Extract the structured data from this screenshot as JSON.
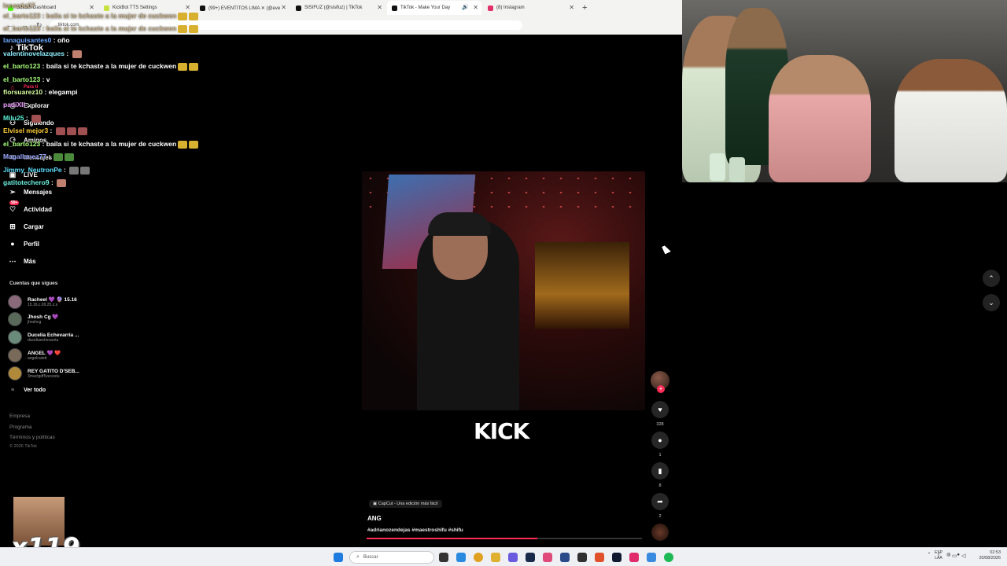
{
  "browser": {
    "tabs": [
      {
        "label": "Stream",
        "extra": "Dashboard",
        "color": "#53fc18"
      },
      {
        "label": "KickBot TTS Settings",
        "color": "#c7e23a"
      },
      {
        "label": "(99+) EVENTITOS LIMA ✕ (@eve",
        "color": "#111111"
      },
      {
        "label": "SISIFUZ (@sisifuz) | TikTok",
        "color": "#111111"
      },
      {
        "label": "TikTok - Make Your Day",
        "color": "#111111"
      },
      {
        "label": "(8) Instagram",
        "color": "#e1306c"
      }
    ],
    "active_tab": 4,
    "url": "tiktok.com",
    "new_tab": "+"
  },
  "tiktok": {
    "logo": "TikTok",
    "nav": [
      {
        "label": "Para ti",
        "icon": "home-icon"
      },
      {
        "label": "Explorar",
        "icon": "compass-icon"
      },
      {
        "label": "Siguiendo",
        "icon": "following-icon"
      },
      {
        "label": "Amigos",
        "icon": "friends-icon"
      },
      {
        "label": "Mensajes",
        "icon": "mail-icon"
      },
      {
        "label": "LIVE",
        "icon": "live-icon"
      },
      {
        "label": "Mensajes",
        "icon": "message-icon"
      },
      {
        "label": "Actividad",
        "icon": "bell-icon",
        "badge": "99+"
      },
      {
        "label": "Cargar",
        "icon": "upload-icon"
      },
      {
        "label": "Perfil",
        "icon": "profile-icon"
      },
      {
        "label": "Más",
        "icon": "more-icon"
      }
    ],
    "following_title": "Cuentas que sigues",
    "accounts": [
      {
        "name": "Racheel 💜 🔮 15.16",
        "handle": "15.16.c.09.25.z.s"
      },
      {
        "name": "Jhosh Cg 💜",
        "handle": "jhoshcg"
      },
      {
        "name": "Ducelia Echevarria ...",
        "handle": "duceliaechevarria"
      },
      {
        "name": "ANGEL 💜 ❤️",
        "handle": "angelcutett"
      },
      {
        "name": "REY GATITO D'SEB...",
        "handle": "3mactgdf5vecestu"
      }
    ],
    "see_all": "Ver todo",
    "footer": [
      "Empresa",
      "Programa",
      "Términos y políticas"
    ],
    "copyright": "© 2026 TikTok",
    "video": {
      "overlay_text": "KICK",
      "capcut": "CapCut - Una edición más fácil",
      "title": "ANG",
      "tags": "#adrianozendejas #maestroshifu #shifu",
      "progress": 0.62
    },
    "actions": {
      "likes": "328",
      "comments": "1",
      "saves": "8",
      "shares": "2"
    }
  },
  "chat": {
    "top_lines": [
      "lonardo07",
      "el_barto123 : baila si te kchaste a la mujer de cuckwen",
      "el_barto123 : baila si te kchaste a la mujer de cuckwen"
    ],
    "lines": [
      {
        "user": "lanaguisantes0",
        "msg": " : oño",
        "color": "#6aa7ff"
      },
      {
        "user": "valentinovelazques",
        "msg": " : ",
        "color": "#8ef0ff"
      },
      {
        "user": "el_barto123",
        "msg": " : baila si te kchaste a la mujer de cuckwen",
        "color": "#a8ff7a"
      },
      {
        "user": "el_barto123",
        "msg": " : v",
        "color": "#a8ff7a"
      },
      {
        "user": "florsuarez10",
        "msg": " : elegampi",
        "color": "#d9ffa0"
      },
      {
        "user": "padiXII",
        "msg": " : ",
        "color": "#f0a0ff"
      },
      {
        "user": "Milu25",
        "msg": " : ",
        "color": "#5ef0d8"
      },
      {
        "user": "Elvisel mejor3",
        "msg": " : ",
        "color": "#ffcf3a"
      },
      {
        "user": "el_barto123",
        "msg": " : baila si te kchaste a la mujer de cuckwen",
        "color": "#a8ff7a"
      },
      {
        "user": "Magallanez77",
        "msg": " : ",
        "color": "#9aa7ff"
      },
      {
        "user": "Jimmy_NeutronPe",
        "msg": " : ",
        "color": "#5ee0ff"
      },
      {
        "user": "gatitotechero9",
        "msg": " : ",
        "color": "#6cf0e0"
      }
    ]
  },
  "stream": {
    "sub_count": "x119"
  },
  "taskbar": {
    "search_placeholder": "Buscar",
    "lang_top": "ESP",
    "lang_bottom": "LAA",
    "time": "02:53",
    "date": "20/08/2026"
  },
  "colors": {
    "accent": "#fe2c55",
    "background": "#000000"
  }
}
